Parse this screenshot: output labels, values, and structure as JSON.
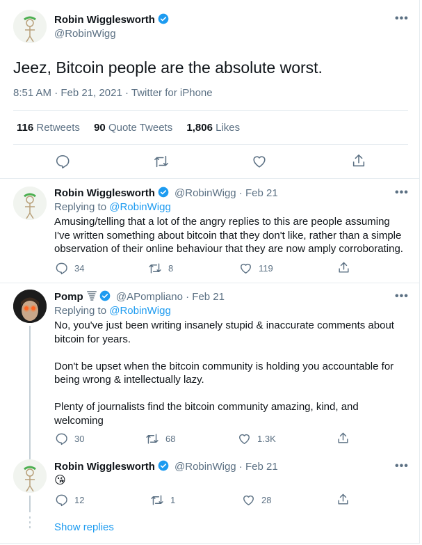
{
  "main": {
    "author_name": "Robin Wigglesworth",
    "author_handle": "@RobinWigg",
    "text": "Jeez, Bitcoin people are the absolute worst.",
    "time": "8:51 AM",
    "sep": "·",
    "date": "Feb 21, 2021",
    "source": "Twitter for iPhone",
    "stats": [
      {
        "count": "116",
        "label": "Retweets"
      },
      {
        "count": "90",
        "label": "Quote Tweets"
      },
      {
        "count": "1,806",
        "label": "Likes"
      }
    ]
  },
  "replying_label": "Replying to",
  "replies": [
    {
      "name": "Robin Wigglesworth",
      "handle": "@RobinWigg",
      "date": "Feb 21",
      "replying_to": "@RobinWigg",
      "lines": [
        "Amusing/telling that a lot of the angry replies to this are people assuming",
        "I've written something about bitcoin that they don't like, rather than a simple",
        "observation of their online behaviour that they are now amply corroborating."
      ],
      "replies_count": "34",
      "retweets": "8",
      "likes": "119"
    },
    {
      "name": "Pomp",
      "handle": "@APompliano",
      "date": "Feb 21",
      "replying_to": "@RobinWigg",
      "lines": [
        "No, you've just been writing insanely stupid & inaccurate comments about",
        "bitcoin for years.",
        "",
        "Don't be upset when the bitcoin community is holding you accountable for",
        "being wrong & intellectually lazy.",
        "",
        "Plenty of journalists find the bitcoin community amazing, kind, and",
        "welcoming"
      ],
      "replies_count": "30",
      "retweets": "68",
      "likes": "1.3K"
    },
    {
      "name": "Robin Wigglesworth",
      "handle": "@RobinWigg",
      "date": "Feb 21",
      "emoji": "😘",
      "replies_count": "12",
      "retweets": "1",
      "likes": "28"
    }
  ],
  "show_replies": "Show replies",
  "colors": {
    "accent": "#1d9bf0",
    "secondary": "#5b7083",
    "divider": "#e6ecf0"
  }
}
